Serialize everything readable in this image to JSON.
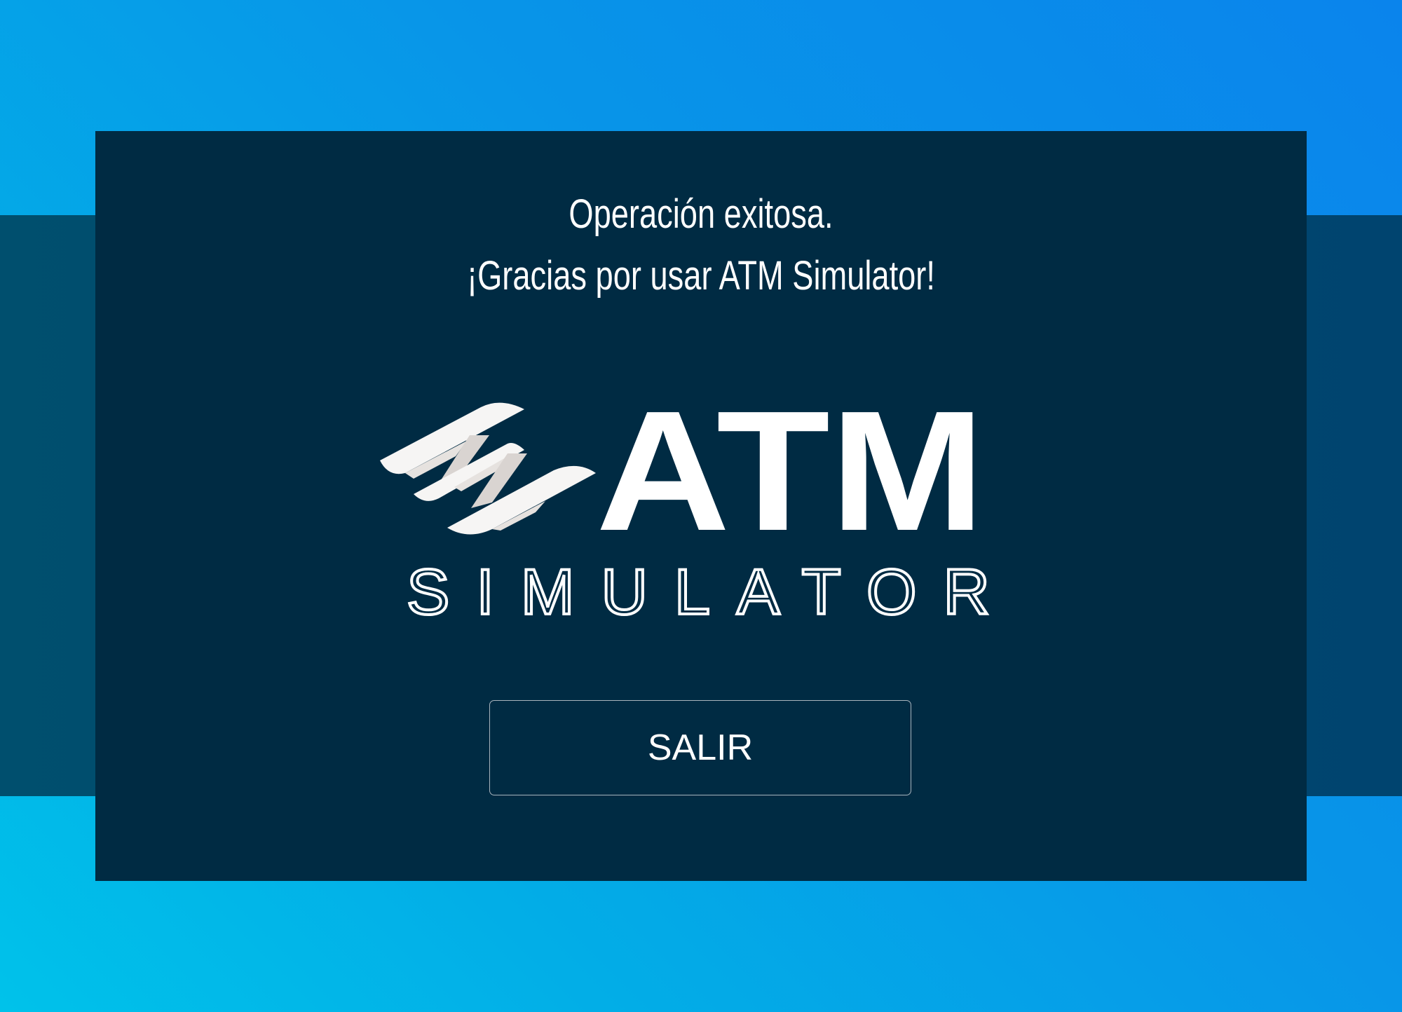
{
  "message": {
    "line1": "Operación exitosa.",
    "line2": "¡Gracias por usar ATM Simulator!"
  },
  "logo": {
    "primary": "ATM",
    "secondary": "SIMULATOR",
    "mark_icon": "stacked-wings-logo-icon"
  },
  "actions": {
    "exit_label": "SALIR"
  },
  "colors": {
    "panel": "#002b43",
    "band": "#004d70",
    "background_gradient": [
      "#00c2ea",
      "#0a84ec"
    ],
    "text": "#ffffff",
    "logo_mark_light": "#f6f5f4",
    "logo_mark_shadow": "#d9d4d1",
    "button_border": "#a9b4bd"
  }
}
